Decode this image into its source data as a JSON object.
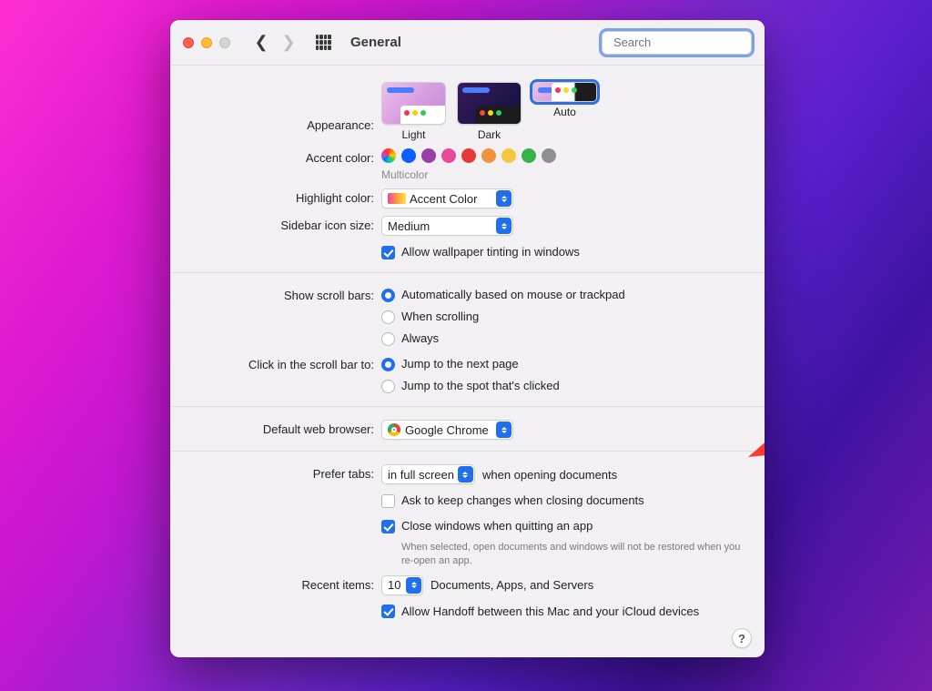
{
  "title": "General",
  "search": {
    "placeholder": "Search"
  },
  "appearance": {
    "label": "Appearance:",
    "options": {
      "light": "Light",
      "dark": "Dark",
      "auto": "Auto"
    },
    "selected": "auto"
  },
  "accent": {
    "label": "Accent color:",
    "selected_name": "Multicolor",
    "colors": [
      "multicolor",
      "#0a60ff",
      "#9a3ea8",
      "#e84a9a",
      "#e6393b",
      "#f1933a",
      "#f4c83c",
      "#36b24a",
      "#8e8e93"
    ]
  },
  "highlight": {
    "label": "Highlight color:",
    "value": "Accent Color"
  },
  "sidebar": {
    "label": "Sidebar icon size:",
    "value": "Medium"
  },
  "tinting": {
    "label": "Allow wallpaper tinting in windows",
    "checked": true
  },
  "scrollbars": {
    "label": "Show scroll bars:",
    "options": {
      "auto": "Automatically based on mouse or trackpad",
      "scrolling": "When scrolling",
      "always": "Always"
    },
    "selected": "auto"
  },
  "clickin": {
    "label": "Click in the scroll bar to:",
    "options": {
      "next": "Jump to the next page",
      "spot": "Jump to the spot that's clicked"
    },
    "selected": "next"
  },
  "browser": {
    "label": "Default web browser:",
    "value": "Google Chrome"
  },
  "tabs": {
    "label": "Prefer tabs:",
    "value": "in full screen",
    "suffix": "when opening documents"
  },
  "ask_keep": {
    "label": "Ask to keep changes when closing documents",
    "checked": false
  },
  "close_quit": {
    "label": "Close windows when quitting an app",
    "checked": true,
    "note": "When selected, open documents and windows will not be restored when you re-open an app."
  },
  "recent": {
    "label": "Recent items:",
    "value": "10",
    "suffix": "Documents, Apps, and Servers"
  },
  "handoff": {
    "label": "Allow Handoff between this Mac and your iCloud devices",
    "checked": true
  }
}
